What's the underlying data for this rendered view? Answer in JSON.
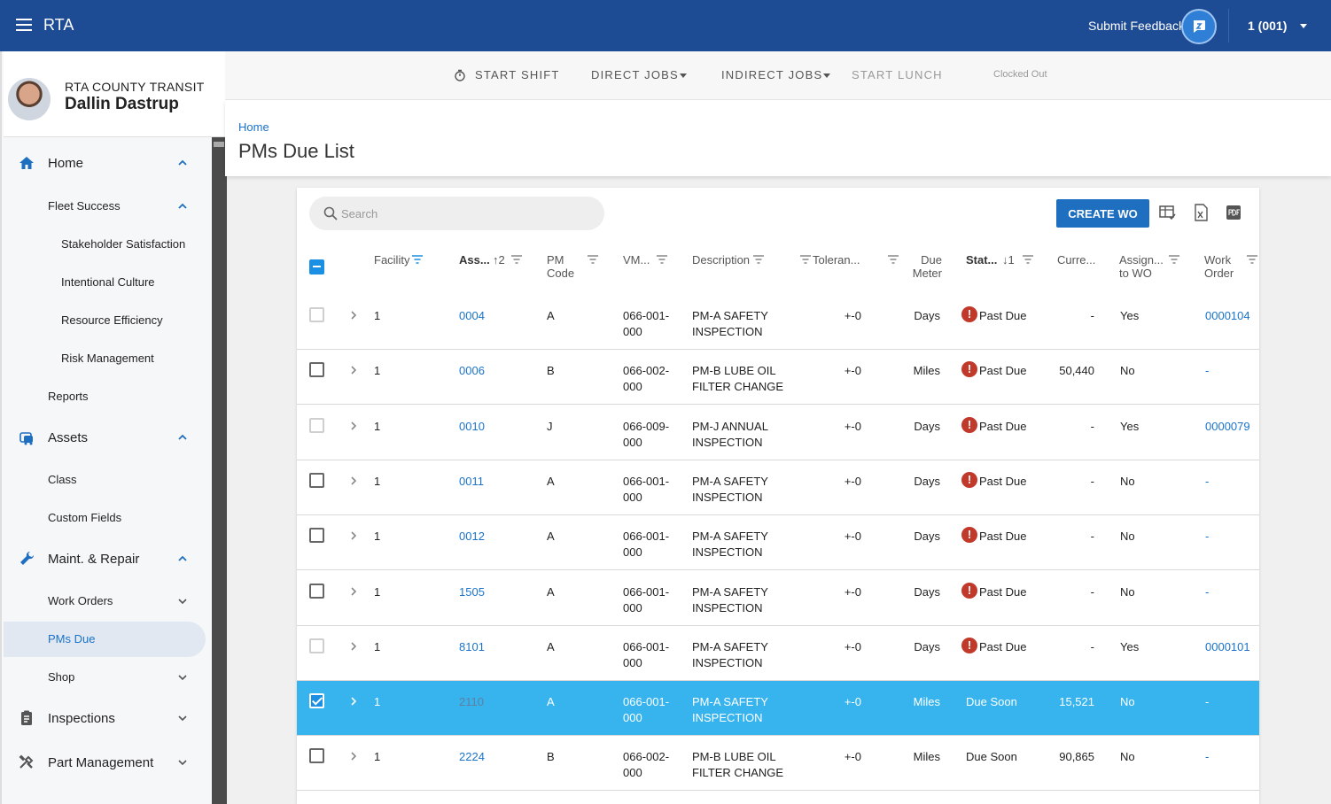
{
  "app": {
    "title": "RTA",
    "feedback_label": "Submit Feedback",
    "user_menu": "1 (001)"
  },
  "profile": {
    "org": "RTA COUNTY TRANSIT",
    "name": "Dallin Dastrup"
  },
  "sidebar": {
    "items": [
      {
        "label": "Home",
        "icon": "home-icon",
        "level": 0,
        "chevron": "up"
      },
      {
        "label": "Fleet Success",
        "level": 1,
        "chevron": "up"
      },
      {
        "label": "Stakeholder Satisfaction",
        "level": 2
      },
      {
        "label": "Intentional Culture",
        "level": 2
      },
      {
        "label": "Resource Efficiency",
        "level": 2
      },
      {
        "label": "Risk Management",
        "level": 2
      },
      {
        "label": "Reports",
        "level": 1
      },
      {
        "label": "Assets",
        "icon": "bus-icon",
        "level": 0,
        "chevron": "up"
      },
      {
        "label": "Class",
        "level": 1
      },
      {
        "label": "Custom Fields",
        "level": 1
      },
      {
        "label": "Maint. & Repair",
        "icon": "wrench-icon",
        "level": 0,
        "chevron": "up"
      },
      {
        "label": "Work Orders",
        "level": 1,
        "chevron": "down"
      },
      {
        "label": "PMs Due",
        "level": 1,
        "active": true
      },
      {
        "label": "Shop",
        "level": 1,
        "chevron": "down"
      },
      {
        "label": "Inspections",
        "icon": "clipboard-icon",
        "level": 0,
        "chevron": "down"
      },
      {
        "label": "Part Management",
        "icon": "tools-icon",
        "level": 0,
        "chevron": "down"
      }
    ]
  },
  "subnav": {
    "start_shift": "START SHIFT",
    "direct_jobs": "DIRECT JOBS",
    "indirect_jobs": "INDIRECT JOBS",
    "start_lunch": "START LUNCH",
    "clock_status": "Clocked Out"
  },
  "header": {
    "breadcrumb": "Home",
    "title": "PMs Due List"
  },
  "toolbar": {
    "search_placeholder": "Search",
    "create_wo": "CREATE WO"
  },
  "columns": [
    {
      "key": "facility",
      "label": "Facility"
    },
    {
      "key": "asset",
      "label": "Ass...",
      "sort": "↑2"
    },
    {
      "key": "pm_code",
      "label": "PM Code"
    },
    {
      "key": "vmrs",
      "label": "VM..."
    },
    {
      "key": "description",
      "label": "Description"
    },
    {
      "key": "tolerance",
      "label": "Toleran..."
    },
    {
      "key": "due_meter",
      "label": "Due Meter"
    },
    {
      "key": "status",
      "label": "Stat...",
      "sort": "↓1"
    },
    {
      "key": "current",
      "label": "Curre..."
    },
    {
      "key": "assigned",
      "label": "Assign... to WO"
    },
    {
      "key": "work_order",
      "label": "Work Order"
    }
  ],
  "rows": [
    {
      "checkbox": "dim",
      "facility": "1",
      "asset": "0004",
      "pm_code": "A",
      "vmrs": "066-001-000",
      "description": "PM-A SAFETY INSPECTION",
      "tolerance": "+-0",
      "due_meter": "Days",
      "status": "Past Due",
      "status_alert": true,
      "current": "-",
      "assigned": "Yes",
      "work_order": "0000104",
      "wo_link": true
    },
    {
      "checkbox": "normal",
      "facility": "1",
      "asset": "0006",
      "pm_code": "B",
      "vmrs": "066-002-000",
      "description": "PM-B LUBE OIL FILTER CHANGE",
      "tolerance": "+-0",
      "due_meter": "Miles",
      "status": "Past Due",
      "status_alert": true,
      "current": "50,440",
      "assigned": "No",
      "work_order": "-",
      "wo_link": false
    },
    {
      "checkbox": "dim",
      "facility": "1",
      "asset": "0010",
      "pm_code": "J",
      "vmrs": "066-009-000",
      "description": "PM-J ANNUAL INSPECTION",
      "tolerance": "+-0",
      "due_meter": "Days",
      "status": "Past Due",
      "status_alert": true,
      "current": "-",
      "assigned": "Yes",
      "work_order": "0000079",
      "wo_link": true
    },
    {
      "checkbox": "normal",
      "facility": "1",
      "asset": "0011",
      "pm_code": "A",
      "vmrs": "066-001-000",
      "description": "PM-A SAFETY INSPECTION",
      "tolerance": "+-0",
      "due_meter": "Days",
      "status": "Past Due",
      "status_alert": true,
      "current": "-",
      "assigned": "No",
      "work_order": "-",
      "wo_link": false
    },
    {
      "checkbox": "normal",
      "facility": "1",
      "asset": "0012",
      "pm_code": "A",
      "vmrs": "066-001-000",
      "description": "PM-A SAFETY INSPECTION",
      "tolerance": "+-0",
      "due_meter": "Days",
      "status": "Past Due",
      "status_alert": true,
      "current": "-",
      "assigned": "No",
      "work_order": "-",
      "wo_link": false
    },
    {
      "checkbox": "normal",
      "facility": "1",
      "asset": "1505",
      "pm_code": "A",
      "vmrs": "066-001-000",
      "description": "PM-A SAFETY INSPECTION",
      "tolerance": "+-0",
      "due_meter": "Days",
      "status": "Past Due",
      "status_alert": true,
      "current": "-",
      "assigned": "No",
      "work_order": "-",
      "wo_link": false
    },
    {
      "checkbox": "dim",
      "facility": "1",
      "asset": "8101",
      "pm_code": "A",
      "vmrs": "066-001-000",
      "description": "PM-A SAFETY INSPECTION",
      "tolerance": "+-0",
      "due_meter": "Days",
      "status": "Past Due",
      "status_alert": true,
      "current": "-",
      "assigned": "Yes",
      "work_order": "0000101",
      "wo_link": true
    },
    {
      "checkbox": "checked",
      "selected": true,
      "facility": "1",
      "asset": "2110",
      "pm_code": "A",
      "vmrs": "066-001-000",
      "description": "PM-A SAFETY INSPECTION",
      "tolerance": "+-0",
      "due_meter": "Miles",
      "status": "Due Soon",
      "status_alert": false,
      "current": "15,521",
      "assigned": "No",
      "work_order": "-",
      "wo_link": false
    },
    {
      "checkbox": "normal",
      "facility": "1",
      "asset": "2224",
      "pm_code": "B",
      "vmrs": "066-002-000",
      "description": "PM-B LUBE OIL FILTER CHANGE",
      "tolerance": "+-0",
      "due_meter": "Miles",
      "status": "Due Soon",
      "status_alert": false,
      "current": "90,865",
      "assigned": "No",
      "work_order": "-",
      "wo_link": false
    }
  ],
  "colors": {
    "brand": "#1d4b94",
    "accent": "#1a73c9",
    "selected_row": "#37b4ee",
    "alert": "#c0392b"
  }
}
